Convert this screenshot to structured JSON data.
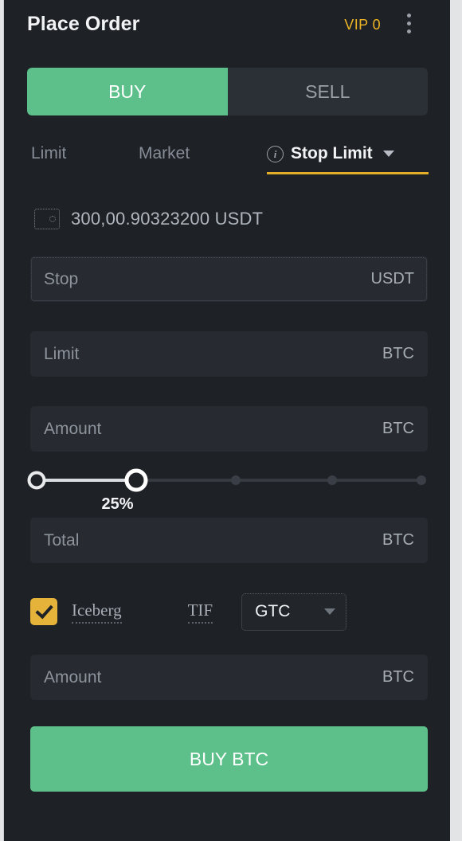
{
  "header": {
    "title": "Place Order",
    "vip_label": "VIP 0",
    "more_icon": "more-vertical-icon"
  },
  "side_toggle": {
    "buy_label": "BUY",
    "sell_label": "SELL",
    "active": "BUY"
  },
  "order_type_tabs": [
    {
      "label": "Limit",
      "active": false
    },
    {
      "label": "Market",
      "active": false
    },
    {
      "label": "Stop Limit",
      "active": true,
      "info_icon": "info-circle-icon",
      "caret_icon": "chevron-down-icon"
    }
  ],
  "balance": {
    "icon": "wallet-icon",
    "amount": "300,00.90323200",
    "currency": "USDT",
    "text": "300,00.90323200 USDT"
  },
  "fields": {
    "stop": {
      "placeholder": "Stop",
      "value": "",
      "unit": "USDT"
    },
    "limit": {
      "placeholder": "Limit",
      "value": "",
      "unit": "BTC"
    },
    "amount": {
      "placeholder": "Amount",
      "value": "",
      "unit": "BTC"
    },
    "total": {
      "placeholder": "Total",
      "value": "",
      "unit": "BTC"
    },
    "iceberg_amount": {
      "placeholder": "Amount",
      "value": "",
      "unit": "BTC"
    }
  },
  "slider": {
    "value_label": "25%",
    "value": 25,
    "steps": [
      0,
      25,
      50,
      75,
      100
    ]
  },
  "iceberg": {
    "checked": true,
    "check_icon": "checkmark-icon",
    "label": "Iceberg",
    "tif_label": "TIF",
    "tif_value": "GTC",
    "tif_caret_icon": "chevron-down-icon"
  },
  "submit": {
    "label": "BUY BTC"
  },
  "colors": {
    "buy_green": "#5dc08a",
    "accent_gold": "#e4ae28",
    "panel_bg": "#1e2126",
    "field_bg": "#272b31"
  }
}
